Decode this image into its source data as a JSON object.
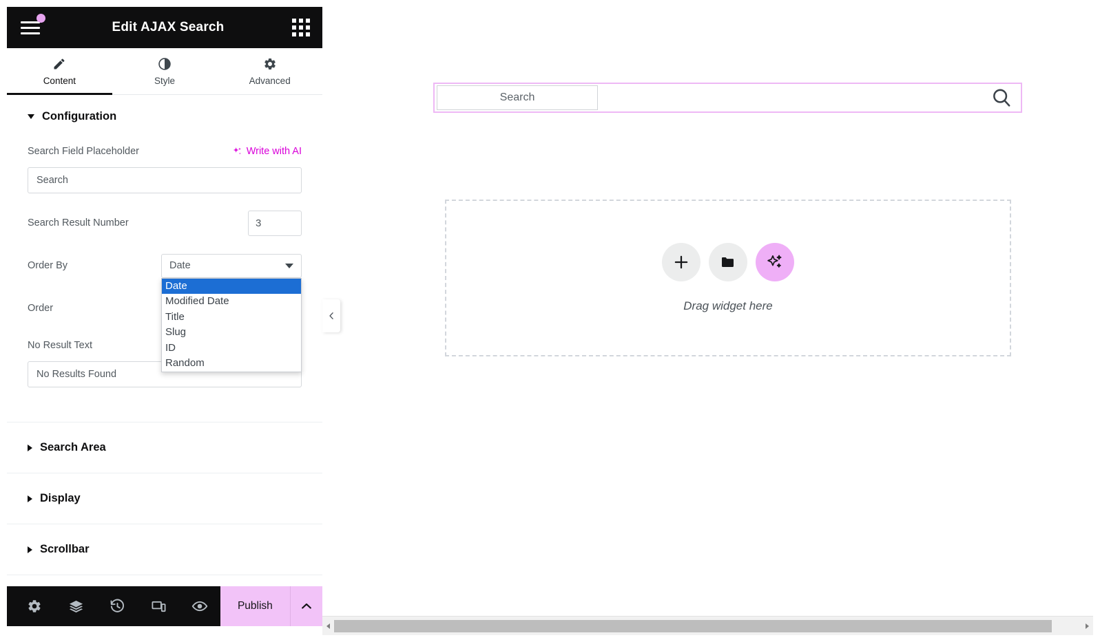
{
  "panel": {
    "header": {
      "title": "Edit AJAX Search",
      "menu_icon": "hamburger-icon",
      "apps_icon": "apps-grid-icon",
      "badge_color": "#e6a3ef"
    },
    "tabs": [
      {
        "label": "Content",
        "icon": "pencil-icon",
        "active": true
      },
      {
        "label": "Style",
        "icon": "contrast-icon",
        "active": false
      },
      {
        "label": "Advanced",
        "icon": "gear-icon",
        "active": false
      }
    ],
    "sections": {
      "configuration": {
        "title": "Configuration",
        "expanded": true,
        "fields": {
          "placeholder": {
            "label": "Search Field Placeholder",
            "value": "Search",
            "ai_link": "Write with AI",
            "ai_link_color": "#d900d9"
          },
          "result_number": {
            "label": "Search Result Number",
            "value": "3"
          },
          "order_by": {
            "label": "Order By",
            "value": "Date",
            "open": true,
            "options": [
              "Date",
              "Modified Date",
              "Title",
              "Slug",
              "ID",
              "Random"
            ],
            "selected_index": 0,
            "highlight_color": "#1c6ed4"
          },
          "order": {
            "label": "Order"
          },
          "no_result_text": {
            "label": "No Result Text",
            "value": "No Results Found"
          }
        }
      },
      "collapsed": [
        {
          "title": "Search Area"
        },
        {
          "title": "Display"
        },
        {
          "title": "Scrollbar"
        }
      ]
    },
    "footer": {
      "icons": [
        "settings-gear-icon",
        "layers-navigator-icon",
        "history-icon",
        "responsive-mode-icon",
        "preview-eye-icon"
      ],
      "publish_label": "Publish",
      "publish_color": "#f2c3f8",
      "publish_caret_icon": "chevron-up-icon"
    },
    "collapse_handle_icon": "chevron-left-icon"
  },
  "canvas": {
    "search_widget": {
      "placeholder": "Search",
      "search_icon": "magnifier-icon",
      "selection_color": "#eeb8f5"
    },
    "dropzone": {
      "label": "Drag widget here",
      "buttons": [
        {
          "icon": "plus-icon",
          "kind": "add-element"
        },
        {
          "icon": "folder-icon",
          "kind": "templates"
        },
        {
          "icon": "ai-sparkle-icon",
          "kind": "ai-builder"
        }
      ]
    }
  }
}
